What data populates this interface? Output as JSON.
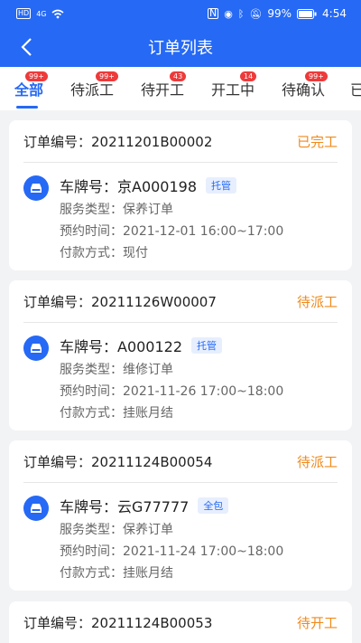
{
  "status_bar": {
    "network": "4G",
    "battery": "99%",
    "time": "4:54"
  },
  "header": {
    "title": "订单列表"
  },
  "tabs": [
    {
      "label": "全部",
      "badge": "99+"
    },
    {
      "label": "待派工",
      "badge": "99+"
    },
    {
      "label": "待开工",
      "badge": "43"
    },
    {
      "label": "开工中",
      "badge": "14"
    },
    {
      "label": "待确认",
      "badge": "99+"
    },
    {
      "label": "已"
    }
  ],
  "orders": [
    {
      "order_no": "订单编号：20211201B00002",
      "status": "已完工",
      "plate": "车牌号：京A000198",
      "tag": "托管",
      "service": "服务类型：保养订单",
      "time": "预约时间：2021-12-01 16:00~17:00",
      "payment": "付款方式：现付"
    },
    {
      "order_no": "订单编号：20211126W00007",
      "status": "待派工",
      "plate": "车牌号：A000122",
      "tag": "托管",
      "service": "服务类型：维修订单",
      "time": "预约时间：2021-11-26 17:00~18:00",
      "payment": "付款方式：挂账月结"
    },
    {
      "order_no": "订单编号：20211124B00054",
      "status": "待派工",
      "plate": "车牌号：云G77777",
      "tag": "全包",
      "service": "服务类型：保养订单",
      "time": "预约时间：2021-11-24 17:00~18:00",
      "payment": "付款方式：挂账月结"
    },
    {
      "order_no": "订单编号：20211124B00053",
      "status": "待开工"
    }
  ],
  "colors": {
    "primary": "#2569f5",
    "status_orange": "#f08a1c",
    "badge_red": "#ee3a3a"
  }
}
